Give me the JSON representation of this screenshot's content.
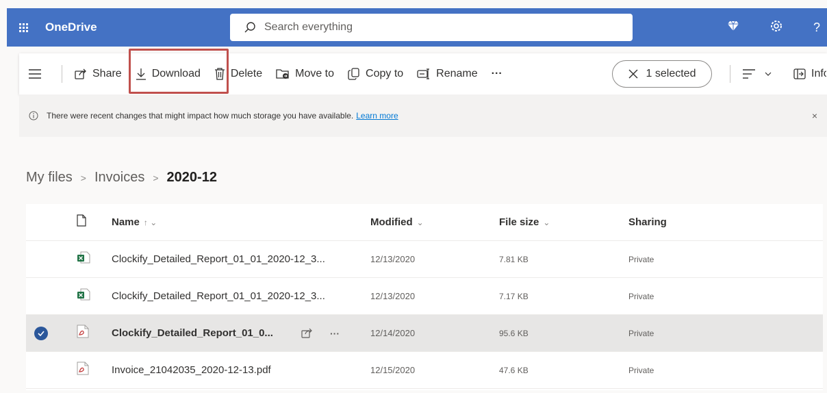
{
  "topbar": {
    "app_name": "OneDrive",
    "search_placeholder": "Search everything",
    "icons": [
      "app-launcher-icon",
      "diamond-icon",
      "gear-icon",
      "help-icon"
    ],
    "help_label": "?"
  },
  "commandbar": {
    "share": "Share",
    "download": "Download",
    "delete": "Delete",
    "move_to": "Move to",
    "copy_to": "Copy to",
    "rename": "Rename",
    "more": "···",
    "selected": "1 selected",
    "info": "Info",
    "highlight_color": "#c0504d"
  },
  "notice": {
    "text": "There were recent changes that might impact how much storage you have available.",
    "link": "Learn more",
    "close": "×"
  },
  "breadcrumb": {
    "items": [
      "My files",
      "Invoices"
    ],
    "current": "2020-12"
  },
  "table": {
    "headers": {
      "name": "Name",
      "name_sort": "↑ ⌄",
      "modified": "Modified",
      "modified_sort": "⌄",
      "size": "File size",
      "size_sort": "⌄",
      "sharing": "Sharing"
    },
    "rows": [
      {
        "name": "Clockify_Detailed_Report_01_01_2020-12_3...",
        "modified": "12/13/2020",
        "size": "7.81 KB",
        "sharing": "Private",
        "type": "excel"
      },
      {
        "name": "Clockify_Detailed_Report_01_01_2020-12_3...",
        "modified": "12/13/2020",
        "size": "7.17 KB",
        "sharing": "Private",
        "type": "excel"
      },
      {
        "name": "Clockify_Detailed_Report_01_0...",
        "modified": "12/14/2020",
        "size": "95.6 KB",
        "sharing": "Private",
        "type": "pdf",
        "selected": true,
        "more": "···"
      },
      {
        "name": "Invoice_21042035_2020-12-13.pdf",
        "modified": "12/15/2020",
        "size": "47.6 KB",
        "sharing": "Private",
        "type": "pdf"
      }
    ]
  },
  "colors": {
    "topbar": "#4472c4",
    "selected_check": "#2b579a",
    "excel_green": "#217346",
    "pdf_red": "#c43e3e"
  }
}
